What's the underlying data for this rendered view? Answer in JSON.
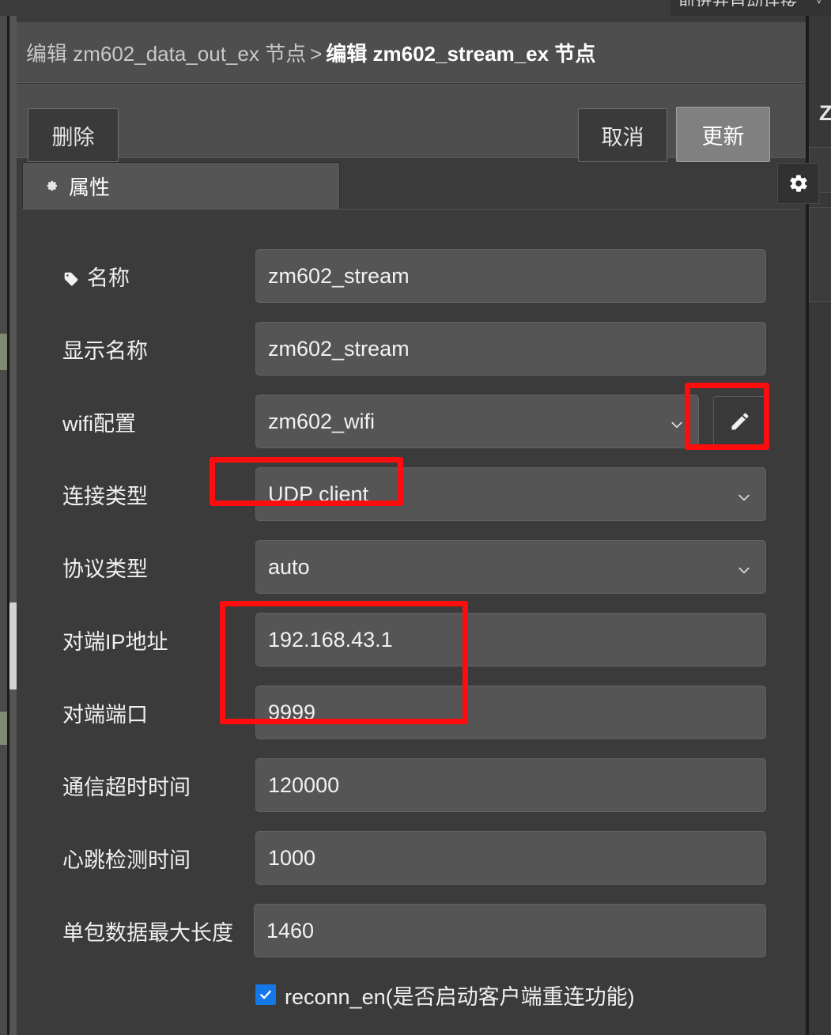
{
  "background": {
    "cut_top_text": "前进并自动连接",
    "cut_top_caret": "˅",
    "right_node_initial": "Z"
  },
  "header": {
    "breadcrumb_prev": "编辑 zm602_data_out_ex 节点",
    "breadcrumb_separator": ">",
    "breadcrumb_current": "编辑 zm602_stream_ex 节点"
  },
  "toolbar": {
    "delete_label": "删除",
    "cancel_label": "取消",
    "update_label": "更新"
  },
  "tabs": {
    "properties_label": "属性",
    "properties_icon": "gear-icon",
    "settings_icon": "gear-icon"
  },
  "form": {
    "rows": [
      {
        "label": "名称",
        "value": "zm602_stream",
        "type": "text",
        "icon": "tag-icon"
      },
      {
        "label": "显示名称",
        "value": "zm602_stream",
        "type": "text"
      },
      {
        "label": "wifi配置",
        "value": "zm602_wifi",
        "type": "select-with-edit"
      },
      {
        "label": "连接类型",
        "value": "UDP client",
        "type": "select"
      },
      {
        "label": "协议类型",
        "value": "auto",
        "type": "select"
      },
      {
        "label": "对端IP地址",
        "value": "192.168.43.1",
        "type": "text"
      },
      {
        "label": "对端端口",
        "value": "9999",
        "type": "text"
      },
      {
        "label": "通信超时时间",
        "value": "120000",
        "type": "text"
      },
      {
        "label": "心跳检测时间",
        "value": "1000",
        "type": "text"
      },
      {
        "label": "单包数据最大长度",
        "value": "1460",
        "type": "text"
      }
    ],
    "checkbox": {
      "label": "reconn_en(是否启动客户端重连功能)",
      "checked": true
    }
  },
  "annotations": {
    "color": "#fd0d0d",
    "boxes": [
      {
        "target": "wifi-edit-button"
      },
      {
        "target": "connection-type-value"
      },
      {
        "target": "peer-ip-and-port-fields"
      }
    ]
  }
}
